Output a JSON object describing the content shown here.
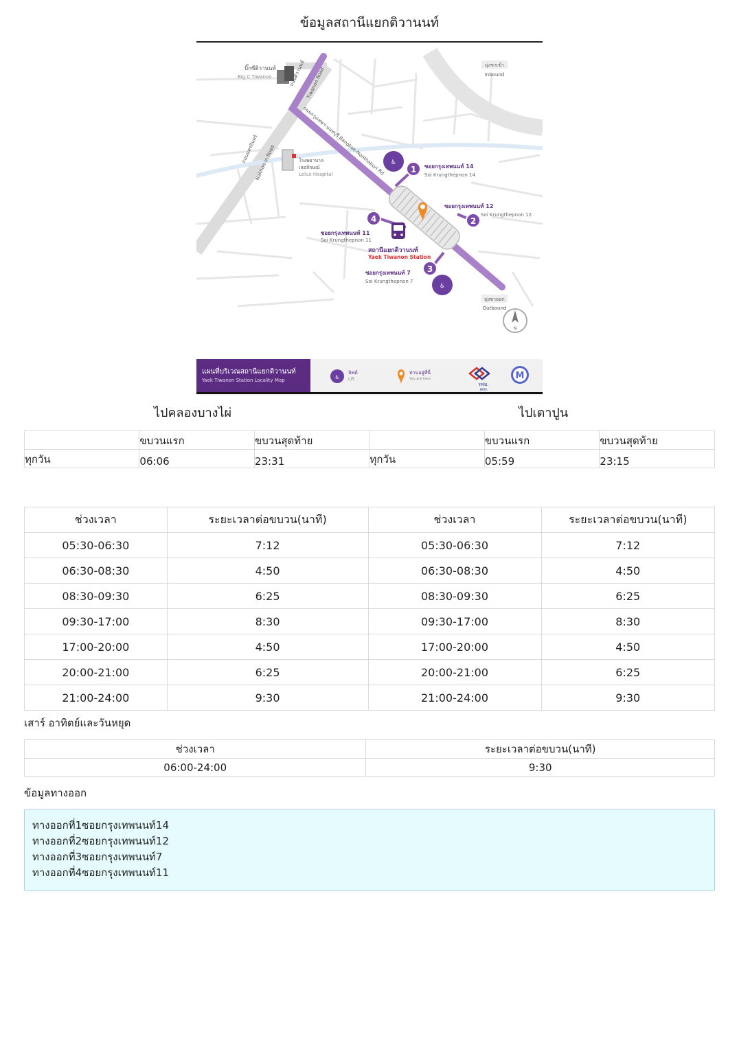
{
  "page": {
    "title": "ข้อมูลสถานีแยกติวานนท์"
  },
  "map": {
    "labels": {
      "bigc_th": "บิ๊กซีติวานนท์",
      "bigc_en": "Big C Tiwanon",
      "tiwanon_road_th": "ถนนติวานนท์",
      "tiwanon_road_en": "Tiwanon Road",
      "nakhonin_th": "ถนนนครอินทร์",
      "nakhonin_en": "Nakhon In Road",
      "hospital_th1": "โรงพยาบาล",
      "hospital_th2": "เลอลักษณ์",
      "hospital_en": "Lelux Hospital",
      "bkk_nont_road": "ถนนกรุงเทพฯ-นนทบุรี Bangkok-Nonthaburi Rd",
      "inbound_th": "มุ่งขาเข้า",
      "inbound_en": "Inbound",
      "outbound_th": "มุ่งขาออก",
      "outbound_en": "Outbound",
      "exit1_th": "ซอยกรุงเทพนนท์ 14",
      "exit1_en": "Soi Krungthepnon 14",
      "exit2_th": "ซอยกรุงเทพนนท์ 12",
      "exit2_en": "Soi Krungthepnon 12",
      "exit3_th": "ซอยกรุงเทพนนท์ 7",
      "exit3_en": "Soi Krungthepnon 7",
      "exit4_th": "ซอยกรุงเทพนนท์ 11",
      "exit4_en": "Soi Krungthepnon 11",
      "station_th": "สถานีแยกติวานนท์",
      "station_en": "Yaek Tiwanon Station",
      "exit_num1": "1",
      "exit_num2": "2",
      "exit_num3": "3",
      "exit_num4": "4",
      "north": "N",
      "lift_icon_text": "Lift ลิฟต์"
    },
    "legend": {
      "title_th": "แผนที่บริเวณสถานีแยกติวานนท์",
      "title_en": "Yaek Tiwanon Station Locality Map",
      "lift_th": "ลิฟต์",
      "lift_en": "Lift",
      "here_th": "ท่านอยู่ที่นี่",
      "here_en": "You are here",
      "mrta_th": "รฟม.",
      "mrta_en": "MRTA",
      "m_logo": "M"
    },
    "colors": {
      "line": "#9b6bbd",
      "line_dark": "#5a2d82",
      "pin": "#f08a24",
      "road": "#e3e3e3"
    }
  },
  "directions": {
    "left": "ไปคลองบางไผ่",
    "right": "ไปเตาปูน"
  },
  "first_last": {
    "headers": {
      "first": "ขบวนแรก",
      "last": "ขบวนสุดท้าย"
    },
    "left": {
      "day": "ทุกวัน",
      "first": "06:06",
      "last": "23:31"
    },
    "right": {
      "day": "ทุกวัน",
      "first": "05:59",
      "last": "23:15"
    }
  },
  "weekday": {
    "headers": {
      "period": "ช่วงเวลา",
      "interval": "ระยะเวลาต่อขบวน(นาที)"
    },
    "rows": [
      {
        "period": "05:30-06:30",
        "interval": "7:12",
        "period2": "05:30-06:30",
        "interval2": "7:12"
      },
      {
        "period": "06:30-08:30",
        "interval": "4:50",
        "period2": "06:30-08:30",
        "interval2": "4:50"
      },
      {
        "period": "08:30-09:30",
        "interval": "6:25",
        "period2": "08:30-09:30",
        "interval2": "6:25"
      },
      {
        "period": "09:30-17:00",
        "interval": "8:30",
        "period2": "09:30-17:00",
        "interval2": "8:30"
      },
      {
        "period": "17:00-20:00",
        "interval": "4:50",
        "period2": "17:00-20:00",
        "interval2": "4:50"
      },
      {
        "period": "20:00-21:00",
        "interval": "6:25",
        "period2": "20:00-21:00",
        "interval2": "6:25"
      },
      {
        "period": "21:00-24:00",
        "interval": "9:30",
        "period2": "21:00-24:00",
        "interval2": "9:30"
      }
    ]
  },
  "weekend": {
    "label": "เสาร์ อาทิตย์และวันหยุด",
    "headers": {
      "period": "ช่วงเวลา",
      "interval": "ระยะเวลาต่อขบวน(นาที)"
    },
    "row": {
      "period": "06:00-24:00",
      "interval": "9:30"
    }
  },
  "exits": {
    "label": "ข้อมูลทางออก",
    "items": [
      "ทางออกที่1ซอยกรุงเทพนนท์14",
      "ทางออกที่2ซอยกรุงเทพนนท์12",
      "ทางออกที่3ซอยกรุงเทพนนท์7",
      "ทางออกที่4ซอยกรุงเทพนนท์11"
    ]
  }
}
